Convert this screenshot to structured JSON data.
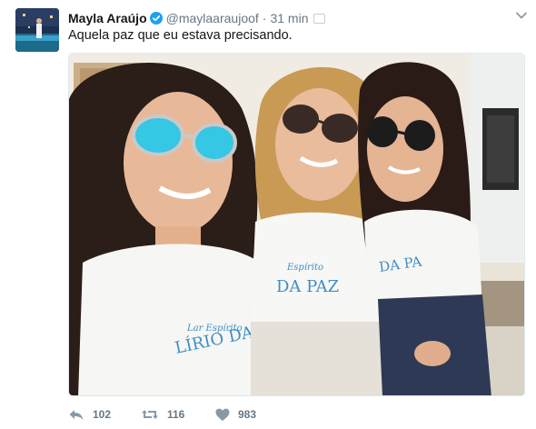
{
  "tweet": {
    "display_name": "Mayla Araújo",
    "handle": "@maylaaraujoof",
    "separator": "·",
    "time": "31 min",
    "text": "Aquela paz que eu estava precisando.",
    "verified": true
  },
  "actions": {
    "reply_count": "102",
    "retweet_count": "116",
    "like_count": "983"
  },
  "media": {
    "shirt_text_left_script": "Lar Espírito",
    "shirt_text_left_main": "LÍRIO DA",
    "shirt_text_middle_script": "Espírito",
    "shirt_text_middle_main": "DA PAZ",
    "shirt_text_right_main": "DA PA"
  },
  "icons": {
    "verified": "verified-badge-icon",
    "caret": "chevron-down-icon",
    "reply": "reply-icon",
    "retweet": "retweet-icon",
    "like": "heart-icon"
  },
  "colors": {
    "verified_blue": "#1da1f2",
    "muted_gray": "#657786",
    "text_dark": "#14171a"
  }
}
